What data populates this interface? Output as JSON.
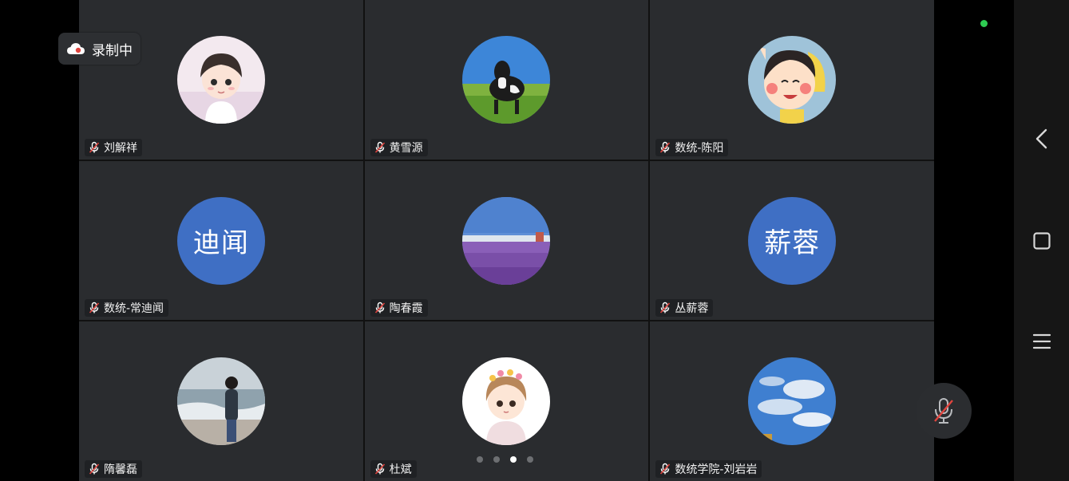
{
  "recording": {
    "label": "录制中",
    "icon": "cloud-icon"
  },
  "participants": [
    {
      "name": "刘解祥",
      "avatar_type": "image",
      "avatar_desc": "cartoon-boy"
    },
    {
      "name": "黄雪源",
      "avatar_type": "image",
      "avatar_desc": "cow-in-meadow"
    },
    {
      "name": "数统-陈阳",
      "avatar_type": "image",
      "avatar_desc": "cartoon-girl-waving"
    },
    {
      "name": "数统-常迪闻",
      "avatar_type": "text",
      "avatar_text": "迪闻",
      "avatar_color": "#3f6fc4"
    },
    {
      "name": "陶春霞",
      "avatar_type": "image",
      "avatar_desc": "lavender-field"
    },
    {
      "name": "丛薪蓉",
      "avatar_type": "text",
      "avatar_text": "薪蓉",
      "avatar_color": "#3f6fc4"
    },
    {
      "name": "隋馨磊",
      "avatar_type": "image",
      "avatar_desc": "person-at-beach"
    },
    {
      "name": "杜斌",
      "avatar_type": "image",
      "avatar_desc": "cartoon-girl-flower-crown"
    },
    {
      "name": "数统学院-刘岩岩",
      "avatar_type": "image",
      "avatar_desc": "blue-sky-clouds"
    }
  ],
  "pager": {
    "total": 4,
    "active": 3
  },
  "system_nav": [
    "back",
    "home",
    "menu"
  ],
  "colors": {
    "tile_bg": "#2a2c2f",
    "text_avatar": "#3f6fc4",
    "status_green": "#2ecc52",
    "muted_red": "#e0443e"
  }
}
